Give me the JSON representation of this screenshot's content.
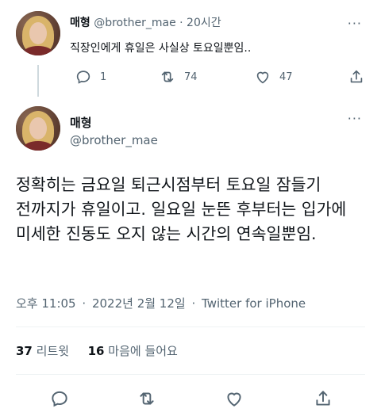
{
  "reply_tweet": {
    "display_name": "매형",
    "handle": "@brother_mae",
    "time_sep": " · ",
    "time": "20시간",
    "text": "직장인에게 휴일은 사실상 토요일뿐임..",
    "more": "···",
    "reply_count": "1",
    "retweet_count": "74",
    "like_count": "47"
  },
  "main_tweet": {
    "display_name": "매형",
    "handle": "@brother_mae",
    "more": "···",
    "text": "정확히는 금요일 퇴근시점부터 토요일 잠들기 전까지가 휴일이고. 일요일 눈뜬 후부터는 입가에 미세한 진동도 오지 않는 시간의 연속일뿐임.",
    "time": "오후 11:05",
    "date": "2022년 2월 12일",
    "dot": "·",
    "source": "Twitter for iPhone",
    "retweets_count": "37",
    "retweets_label": "리트윗",
    "likes_count": "16",
    "likes_label": "마음에 들어요"
  },
  "icons": [
    "reply-icon",
    "retweet-icon",
    "like-icon",
    "share-icon",
    "more-icon"
  ],
  "colors": {
    "text": "#0f1419",
    "muted": "#536471",
    "divider": "#eff3f4"
  }
}
